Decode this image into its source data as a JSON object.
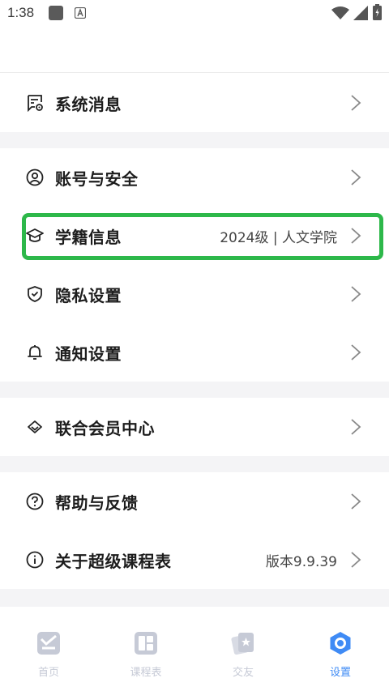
{
  "status": {
    "time": "1:38"
  },
  "menu": {
    "messages": {
      "label": "系统消息",
      "icon": "message-settings-icon"
    },
    "account": {
      "label": "账号与安全",
      "icon": "user-circle-icon"
    },
    "student": {
      "label": "学籍信息",
      "value": "2024级 | 人文学院",
      "icon": "graduation-cap-icon"
    },
    "privacy": {
      "label": "隐私设置",
      "icon": "shield-check-icon"
    },
    "notify": {
      "label": "通知设置",
      "icon": "bell-icon"
    },
    "member": {
      "label": "联合会员中心",
      "icon": "diamond-icon"
    },
    "help": {
      "label": "帮助与反馈",
      "icon": "question-circle-icon"
    },
    "about": {
      "label": "关于超级课程表",
      "value": "版本9.9.39",
      "icon": "info-circle-icon"
    }
  },
  "tabs": [
    {
      "label": "首页",
      "icon": "home-check-icon",
      "active": false
    },
    {
      "label": "课程表",
      "icon": "schedule-grid-icon",
      "active": false
    },
    {
      "label": "交友",
      "icon": "cards-star-icon",
      "active": false
    },
    {
      "label": "设置",
      "icon": "settings-hexagon-icon",
      "active": true
    }
  ],
  "colors": {
    "highlight": "#2db84a",
    "accent": "#3f8bf5",
    "inactive_tab": "#c6cad6",
    "separator": "#f4f4f6"
  }
}
